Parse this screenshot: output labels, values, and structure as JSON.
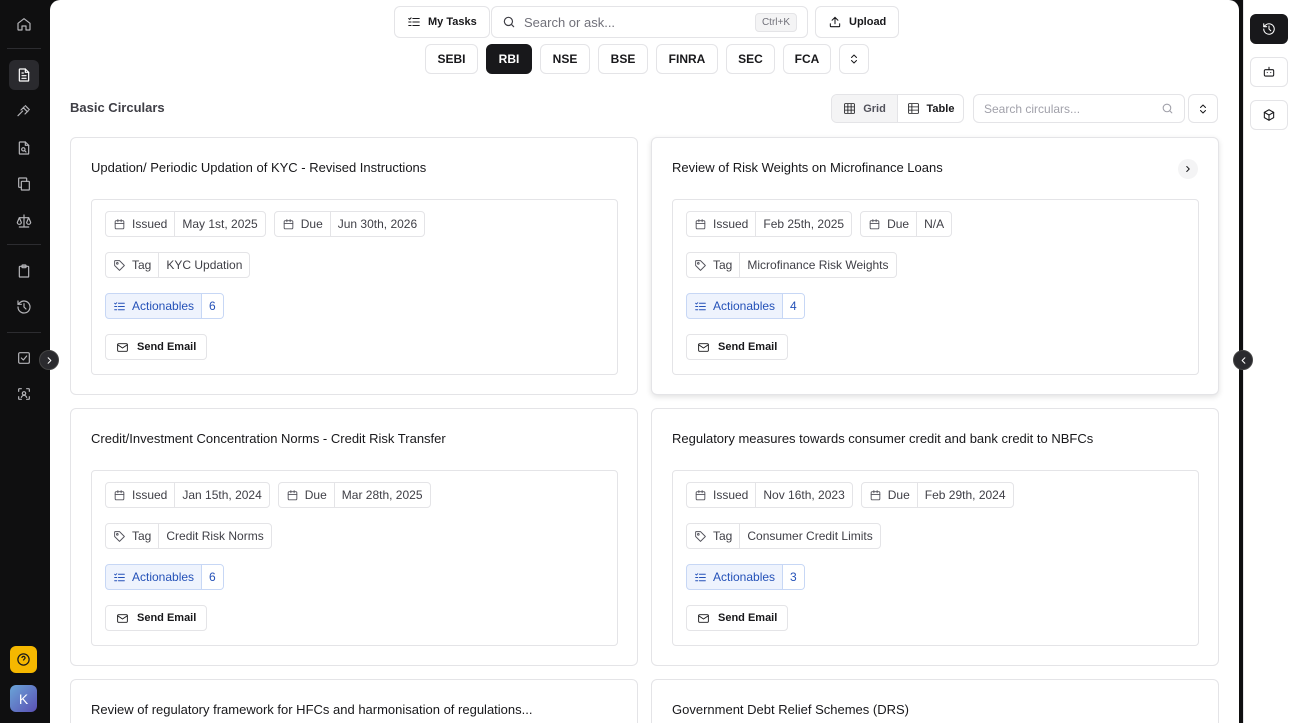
{
  "topbar": {
    "my_tasks": "My Tasks",
    "search_placeholder": "Search or ask...",
    "search_shortcut": "Ctrl+K",
    "upload": "Upload"
  },
  "regulators": {
    "tabs": [
      "SEBI",
      "RBI",
      "NSE",
      "BSE",
      "FINRA",
      "SEC",
      "FCA"
    ],
    "active": "RBI"
  },
  "section": {
    "title": "Basic Circulars",
    "view_grid": "Grid",
    "view_table": "Table",
    "active_view": "Grid",
    "search_placeholder": "Search circulars..."
  },
  "labels": {
    "issued": "Issued",
    "due": "Due",
    "tag": "Tag",
    "actionables": "Actionables",
    "send_email": "Send Email"
  },
  "circulars": [
    {
      "title": "Updation/ Periodic Updation of KYC - Revised Instructions",
      "issued": "May 1st, 2025",
      "due": "Jun 30th, 2026",
      "tag": "KYC Updation",
      "actionables": "6"
    },
    {
      "title": "Review of Risk Weights on Microfinance Loans",
      "issued": "Feb 25th, 2025",
      "due": "N/A",
      "tag": "Microfinance Risk Weights",
      "actionables": "4"
    },
    {
      "title": "Credit/Investment Concentration Norms - Credit Risk Transfer",
      "issued": "Jan 15th, 2024",
      "due": "Mar 28th, 2025",
      "tag": "Credit Risk Norms",
      "actionables": "6"
    },
    {
      "title": "Regulatory measures towards consumer credit and bank credit to NBFCs",
      "issued": "Nov 16th, 2023",
      "due": "Feb 29th, 2024",
      "tag": "Consumer Credit Limits",
      "actionables": "3"
    },
    {
      "title": "Review of regulatory framework for HFCs and harmonisation of regulations..."
    },
    {
      "title": "Government Debt Relief Schemes (DRS)"
    }
  ],
  "user": {
    "avatar_initial": "K"
  },
  "colors": {
    "accent": "#18181b",
    "actionable": "#2451b8",
    "help": "#f5b800"
  }
}
